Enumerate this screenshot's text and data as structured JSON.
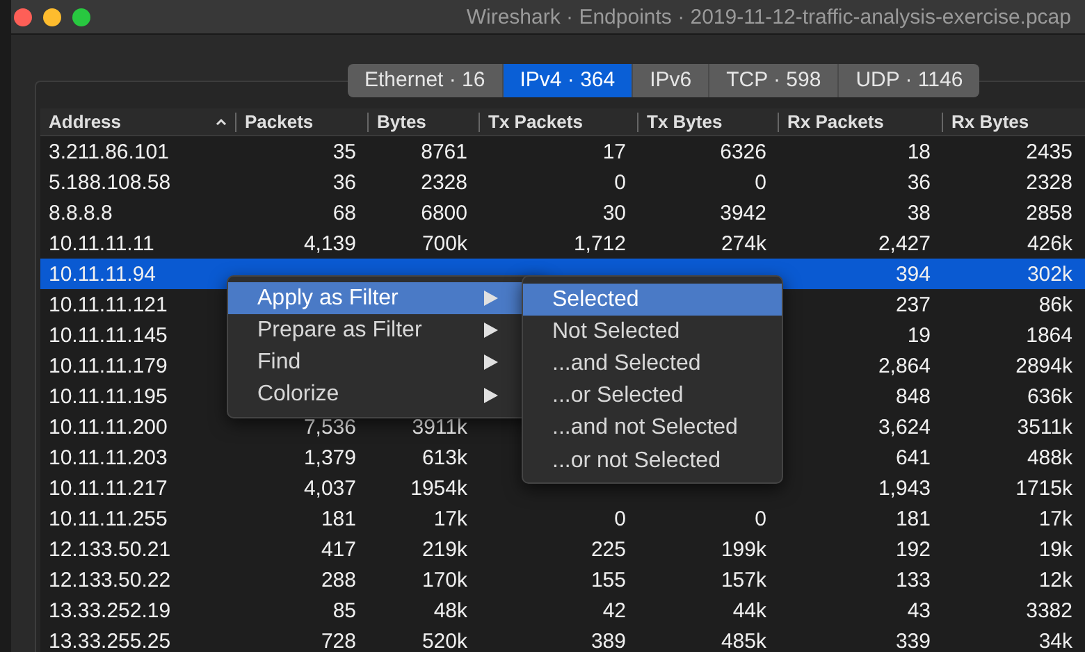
{
  "window": {
    "title": "Wireshark · Endpoints · 2019-11-12-traffic-analysis-exercise.pcap"
  },
  "tabs": [
    {
      "label": "Ethernet · 16",
      "selected": false
    },
    {
      "label": "IPv4 · 364",
      "selected": true
    },
    {
      "label": "IPv6",
      "selected": false
    },
    {
      "label": "TCP · 598",
      "selected": false
    },
    {
      "label": "UDP · 1146",
      "selected": false
    }
  ],
  "table": {
    "columns": [
      {
        "label": "Address",
        "sorted": true
      },
      {
        "label": "Packets",
        "sorted": false
      },
      {
        "label": "Bytes",
        "sorted": false
      },
      {
        "label": "Tx Packets",
        "sorted": false
      },
      {
        "label": "Tx Bytes",
        "sorted": false
      },
      {
        "label": "Rx Packets",
        "sorted": false
      },
      {
        "label": "Rx Bytes",
        "sorted": false
      }
    ],
    "rows": [
      {
        "selected": false,
        "cells": [
          "3.211.86.101",
          "35",
          "8761",
          "17",
          "6326",
          "18",
          "2435"
        ]
      },
      {
        "selected": false,
        "cells": [
          "5.188.108.58",
          "36",
          "2328",
          "0",
          "0",
          "36",
          "2328"
        ]
      },
      {
        "selected": false,
        "cells": [
          "8.8.8.8",
          "68",
          "6800",
          "30",
          "3942",
          "38",
          "2858"
        ]
      },
      {
        "selected": false,
        "cells": [
          "10.11.11.11",
          "4,139",
          "700k",
          "1,712",
          "274k",
          "2,427",
          "426k"
        ]
      },
      {
        "selected": true,
        "cells": [
          "10.11.11.94",
          null,
          null,
          null,
          null,
          "394",
          "302k"
        ]
      },
      {
        "selected": false,
        "cells": [
          "10.11.11.121",
          null,
          null,
          null,
          null,
          "237",
          "86k"
        ]
      },
      {
        "selected": false,
        "cells": [
          "10.11.11.145",
          null,
          null,
          null,
          null,
          "19",
          "1864"
        ]
      },
      {
        "selected": false,
        "cells": [
          "10.11.11.179",
          null,
          null,
          null,
          null,
          "2,864",
          "2894k"
        ]
      },
      {
        "selected": false,
        "cells": [
          "10.11.11.195",
          null,
          null,
          null,
          null,
          "848",
          "636k"
        ]
      },
      {
        "selected": false,
        "cells": [
          "10.11.11.200",
          "7,536",
          "3911k",
          null,
          null,
          "3,624",
          "3511k"
        ]
      },
      {
        "selected": false,
        "cells": [
          "10.11.11.203",
          "1,379",
          "613k",
          null,
          null,
          "641",
          "488k"
        ]
      },
      {
        "selected": false,
        "cells": [
          "10.11.11.217",
          "4,037",
          "1954k",
          null,
          null,
          "1,943",
          "1715k"
        ]
      },
      {
        "selected": false,
        "cells": [
          "10.11.11.255",
          "181",
          "17k",
          "0",
          "0",
          "181",
          "17k"
        ]
      },
      {
        "selected": false,
        "cells": [
          "12.133.50.21",
          "417",
          "219k",
          "225",
          "199k",
          "192",
          "19k"
        ]
      },
      {
        "selected": false,
        "cells": [
          "12.133.50.22",
          "288",
          "170k",
          "155",
          "157k",
          "133",
          "12k"
        ]
      },
      {
        "selected": false,
        "cells": [
          "13.33.252.19",
          "85",
          "48k",
          "42",
          "44k",
          "43",
          "3382"
        ]
      },
      {
        "selected": false,
        "cells": [
          "13.33.255.25",
          "728",
          "520k",
          "389",
          "485k",
          "339",
          "34k"
        ]
      }
    ]
  },
  "context_menu": {
    "items": [
      {
        "label": "Apply as Filter",
        "selected": true,
        "has_submenu": true
      },
      {
        "label": "Prepare as Filter",
        "selected": false,
        "has_submenu": true
      },
      {
        "label": "Find",
        "selected": false,
        "has_submenu": true
      },
      {
        "label": "Colorize",
        "selected": false,
        "has_submenu": true
      }
    ]
  },
  "submenu": {
    "items": [
      {
        "label": "Selected",
        "selected": true
      },
      {
        "label": "Not Selected",
        "selected": false
      },
      {
        "label": "...and Selected",
        "selected": false
      },
      {
        "label": "...or Selected",
        "selected": false
      },
      {
        "label": "...and not Selected",
        "selected": false
      },
      {
        "label": "...or not Selected",
        "selected": false
      }
    ]
  }
}
